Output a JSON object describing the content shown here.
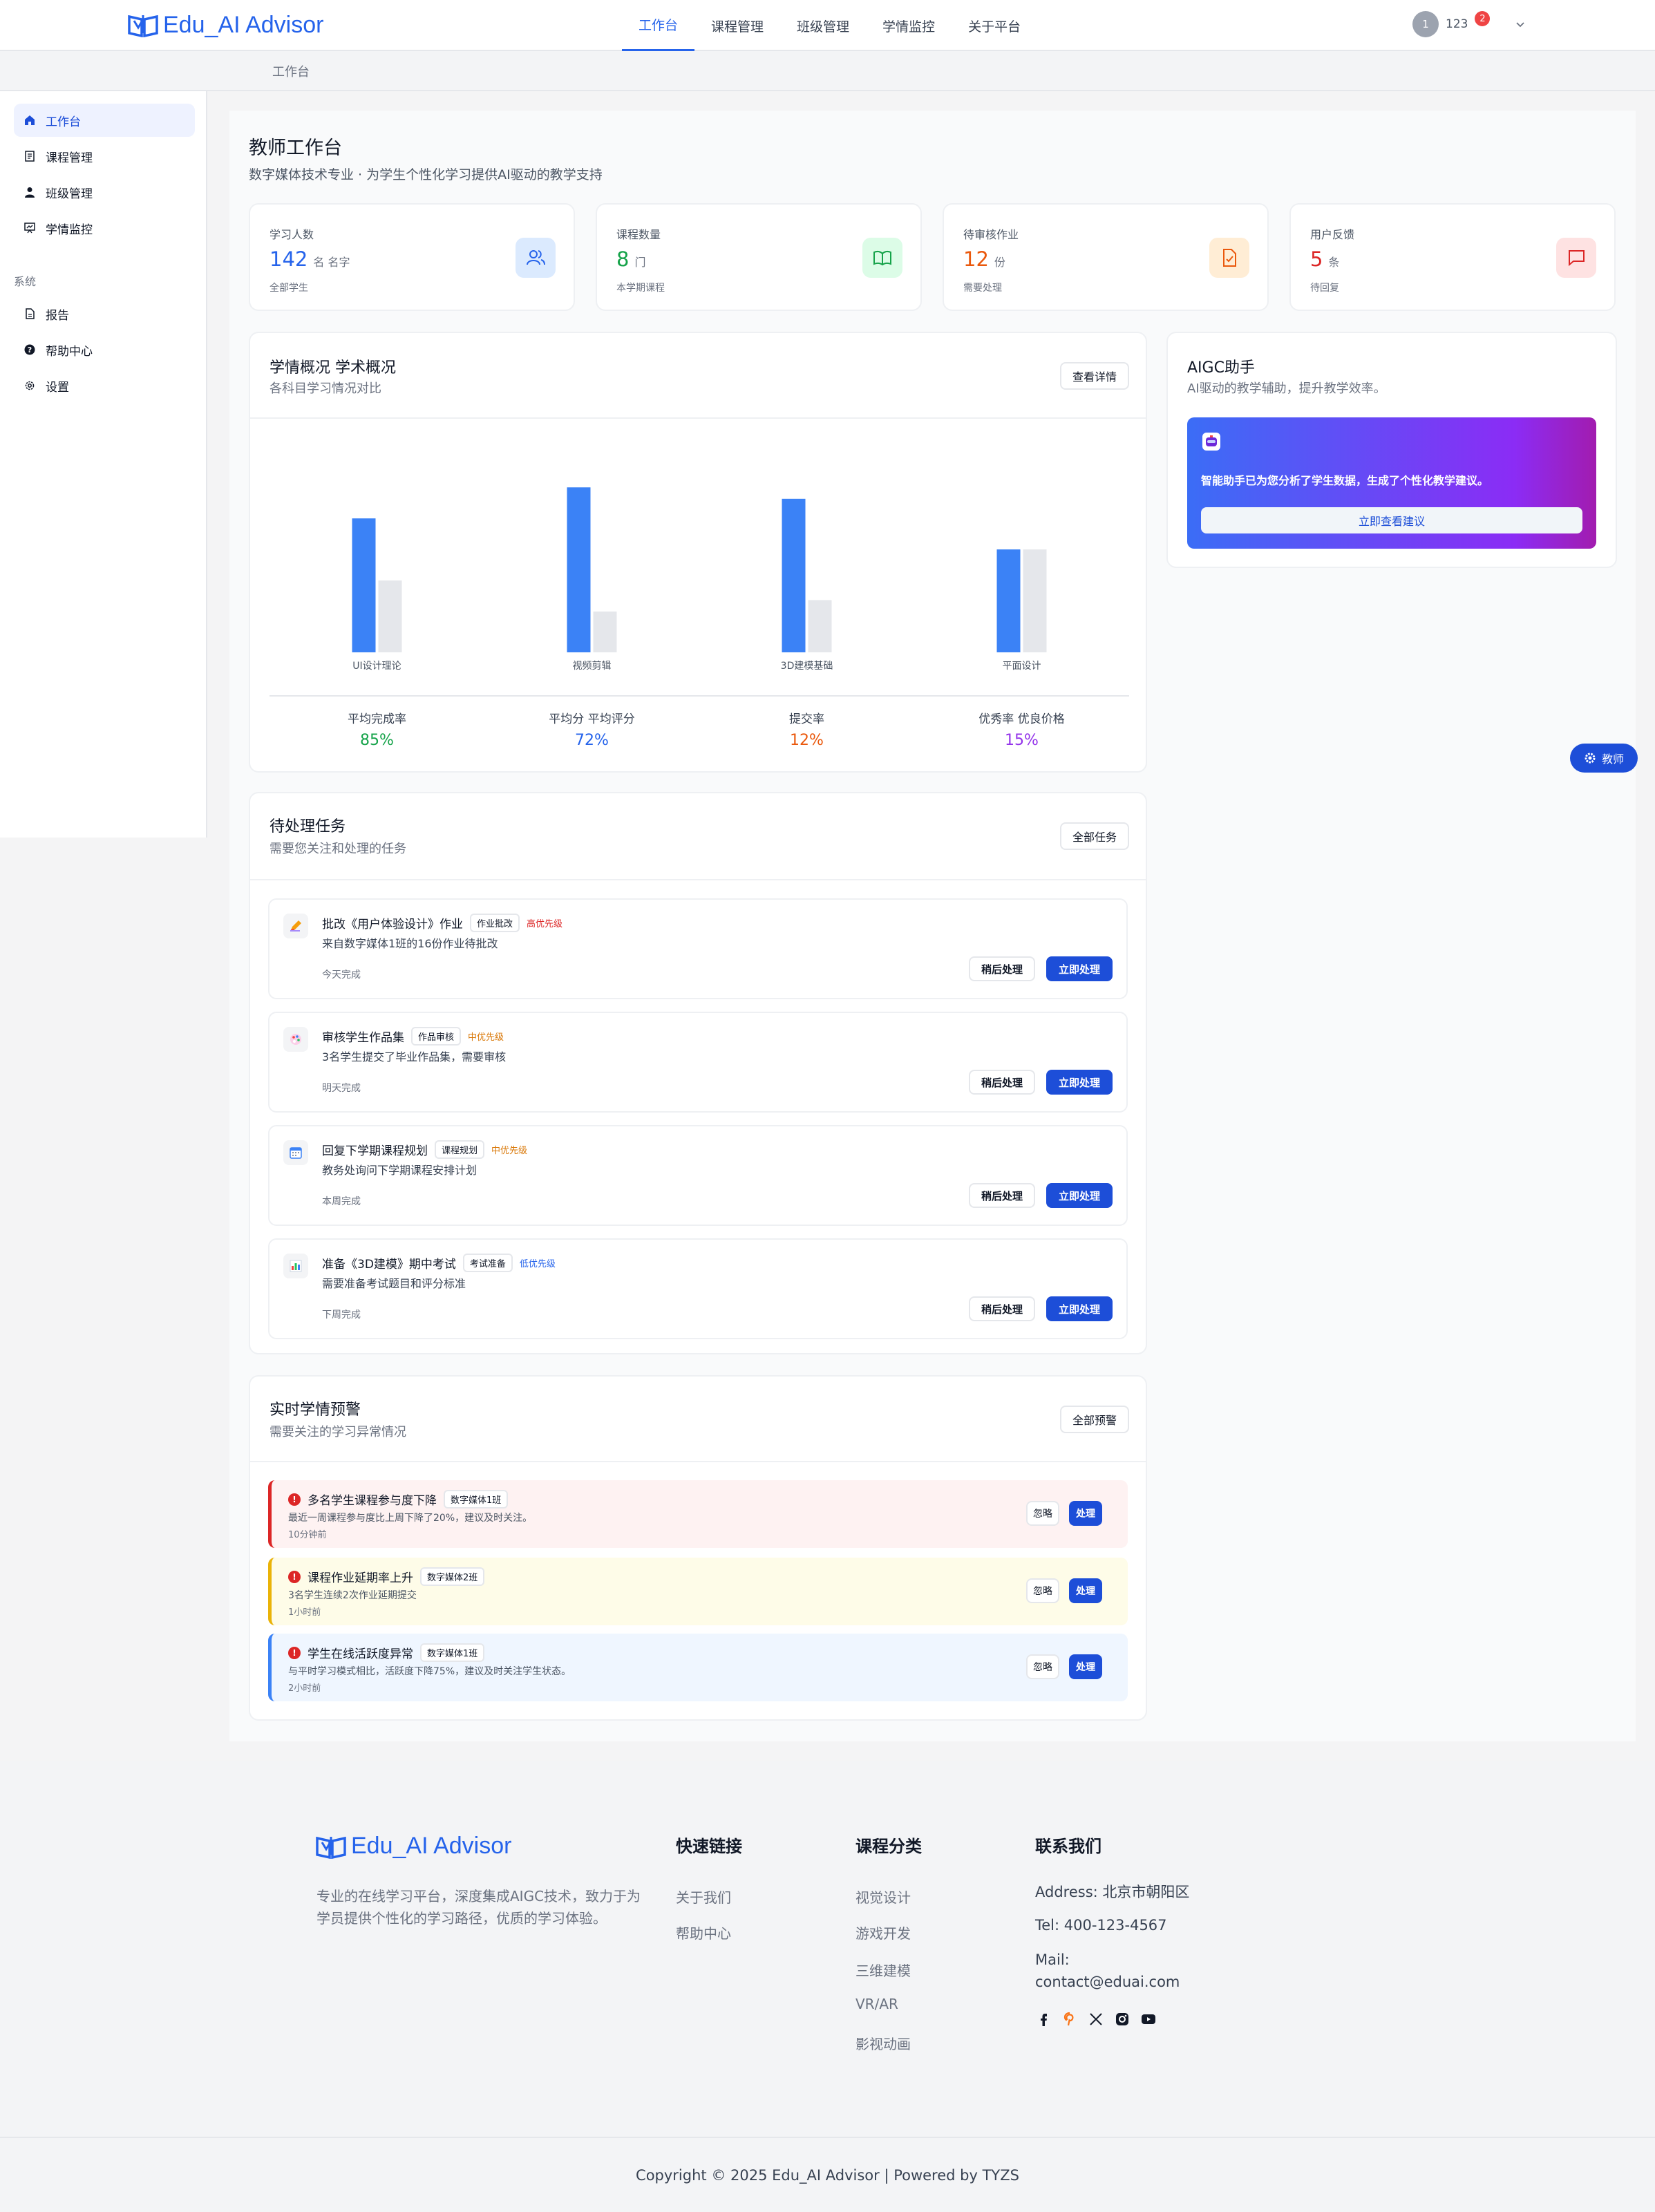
{
  "header": {
    "logo_text": "Edu_AI Advisor",
    "nav": [
      "工作台",
      "课程管理",
      "班级管理",
      "学情监控",
      "关于平台"
    ],
    "user_avatar": "1",
    "user_name": "123",
    "notification_count": "2"
  },
  "breadcrumb": "工作台",
  "sidebar": {
    "items": [
      "工作台",
      "课程管理",
      "班级管理",
      "学情监控"
    ],
    "system_label": "系统",
    "system_items": [
      "报告",
      "帮助中心",
      "设置"
    ]
  },
  "page": {
    "title": "教师工作台",
    "subtitle": "数字媒体技术专业 · 为学生个性化学习提供AI驱动的教学支持"
  },
  "stats": [
    {
      "label": "学习人数",
      "value": "142",
      "unit": "名 名字",
      "note": "全部学生",
      "color": "#2563eb",
      "icon": "users-icon",
      "icon_bg": "#dbeafe"
    },
    {
      "label": "课程数量",
      "value": "8",
      "unit": "门",
      "note": "本学期课程",
      "color": "#16a34a",
      "icon": "book-icon",
      "icon_bg": "#dcfce7"
    },
    {
      "label": "待审核作业",
      "value": "12",
      "unit": "份",
      "note": "需要处理",
      "color": "#ea580c",
      "icon": "file-check-icon",
      "icon_bg": "#ffedd5"
    },
    {
      "label": "用户反馈",
      "value": "5",
      "unit": "条",
      "note": "待回复",
      "color": "#dc2626",
      "icon": "message-icon",
      "icon_bg": "#fee2e2"
    }
  ],
  "overview": {
    "title": "学情概况 学术概况",
    "subtitle": "各科目学习情况对比",
    "button": "查看详情",
    "metrics": [
      {
        "label": "平均完成率",
        "value": "85%",
        "color": "#16a34a"
      },
      {
        "label": "平均分 平均评分",
        "value": "72%",
        "color": "#2563eb"
      },
      {
        "label": "提交率",
        "value": "12%",
        "color": "#ea580c"
      },
      {
        "label": "优秀率 优良价格",
        "value": "15%",
        "color": "#9333ea"
      }
    ]
  },
  "chart_data": {
    "type": "bar",
    "categories": [
      "UI设计理论",
      "视频剪辑",
      "3D建模基础",
      "平面设计"
    ],
    "series": [
      {
        "values": [
          82,
          101,
          94,
          63
        ],
        "color": "#3b82f6"
      },
      {
        "values": [
          44,
          25,
          32,
          63
        ],
        "color": "#e5e7eb"
      }
    ],
    "ylim": [
      0,
      110
    ],
    "grid": false,
    "legend": "none"
  },
  "aigc": {
    "title": "AIGC助手",
    "subtitle": "AI驱动的教学辅助，提升教学效率。",
    "message": "智能助手已为您分析了学生数据，生成了个性化教学建议。",
    "button": "立即查看建议"
  },
  "teacher_chip": "教师",
  "tasks": {
    "title": "待处理任务",
    "subtitle": "需要您关注和处理的任务",
    "button": "全部任务",
    "later_label": "稍后处理",
    "now_label": "立即处理",
    "items": [
      {
        "title": "批改《用户体验设计》作业",
        "tag": "作业批改",
        "priority": "高优先级",
        "priority_color": "#dc2626",
        "desc": "来自数字媒体1班的16份作业待批改",
        "due": "今天完成",
        "icon": "pencil-icon"
      },
      {
        "title": "审核学生作品集",
        "tag": "作品审核",
        "priority": "中优先级",
        "priority_color": "#d97706",
        "desc": "3名学生提交了毕业作品集，需要审核",
        "due": "明天完成",
        "icon": "palette-icon"
      },
      {
        "title": "回复下学期课程规划",
        "tag": "课程规划",
        "priority": "中优先级",
        "priority_color": "#d97706",
        "desc": "教务处询问下学期课程安排计划",
        "due": "本周完成",
        "icon": "calendar-icon"
      },
      {
        "title": "准备《3D建模》期中考试",
        "tag": "考试准备",
        "priority": "低优先级",
        "priority_color": "#2563eb",
        "desc": "需要准备考试题目和评分标准",
        "due": "下周完成",
        "icon": "bar-chart-icon"
      }
    ]
  },
  "alerts": {
    "title": "实时学情预警",
    "subtitle": "需要关注的学习异常情况",
    "button": "全部预警",
    "ignore_label": "忽略",
    "handle_label": "处理",
    "items": [
      {
        "title": "多名学生课程参与度下降",
        "tag": "数字媒体1班",
        "desc": "最近一周课程参与度比上周下降了20%，建议及时关注。",
        "time": "10分钟前",
        "bg": "#fef2f2",
        "border": "#dc2626"
      },
      {
        "title": "课程作业延期率上升",
        "tag": "数字媒体2班",
        "desc": "3名学生连续2次作业延期提交",
        "time": "1小时前",
        "bg": "#fefce8",
        "border": "#eab308"
      },
      {
        "title": "学生在线活跃度异常",
        "tag": "数字媒体1班",
        "desc": "与平时学习模式相比，活跃度下降75%，建议及时关注学生状态。",
        "time": "2小时前",
        "bg": "#eff6ff",
        "border": "#3b82f6"
      }
    ]
  },
  "footer": {
    "logo_text": "Edu_AI Advisor",
    "about": "专业的在线学习平台，深度集成AIGC技术，致力于为学员提供个性化的学习路径，优质的学习体验。",
    "quick_title": "快速链接",
    "quick_links": [
      "关于我们",
      "帮助中心"
    ],
    "category_title": "课程分类",
    "categories": [
      "视觉设计",
      "游戏开发",
      "三维建模",
      "VR/AR",
      "影视动画"
    ],
    "contact_title": "联系我们",
    "address": "Address: 北京市朝阳区",
    "tel": "Tel: 400-123-4567",
    "mail_label": "Mail:",
    "mail": "contact@eduai.com",
    "copyright": "Copyright © 2025 Edu_AI Advisor | Powered by TYZS"
  }
}
